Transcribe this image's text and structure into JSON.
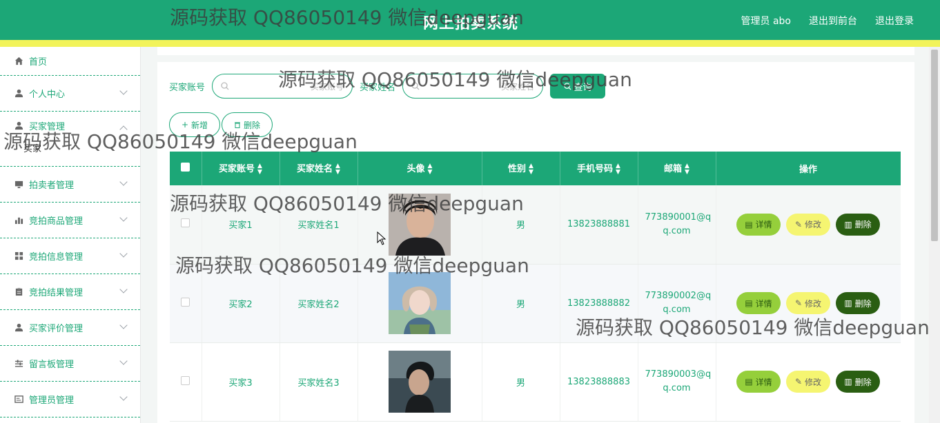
{
  "header": {
    "title": "网上拍卖系统",
    "user_label": "管理员 abo",
    "front_link": "退出到前台",
    "logout_link": "退出登录",
    "bg_color": "#1ca777",
    "stripe_color": "#f2f35a"
  },
  "sidebar": {
    "items": [
      {
        "label": "首页",
        "icon": "home-icon"
      },
      {
        "label": "个人中心",
        "icon": "user-icon"
      },
      {
        "label": "买家管理",
        "icon": "people-icon"
      },
      {
        "label": "拍卖者管理",
        "icon": "monitor-icon"
      },
      {
        "label": "竞拍商品管理",
        "icon": "bar-chart-icon"
      },
      {
        "label": "竞拍信息管理",
        "icon": "grid-icon"
      },
      {
        "label": "竞拍结果管理",
        "icon": "clipboard-icon"
      },
      {
        "label": "买家评价管理",
        "icon": "user-icon"
      },
      {
        "label": "留言板管理",
        "icon": "sliders-icon"
      },
      {
        "label": "管理员管理",
        "icon": "card-icon"
      }
    ],
    "sub_item": "买家"
  },
  "search": {
    "account_label": "买家账号",
    "account_placeholder": "买家账号",
    "name_label": "买家姓名",
    "name_placeholder": "买家姓名",
    "query_button": "查询"
  },
  "actions": {
    "add": "新增",
    "delete": "删除"
  },
  "table": {
    "columns": [
      "买家账号",
      "买家姓名",
      "头像",
      "性别",
      "手机号码",
      "邮箱",
      "操作"
    ],
    "rows": [
      {
        "account": "买家1",
        "name": "买家姓名1",
        "gender": "男",
        "phone": "13823888881",
        "email_a": "773890001@q",
        "email_b": "q.com"
      },
      {
        "account": "买家2",
        "name": "买家姓名2",
        "gender": "男",
        "phone": "13823888882",
        "email_a": "773890002@q",
        "email_b": "q.com"
      },
      {
        "account": "买家3",
        "name": "买家姓名3",
        "gender": "男",
        "phone": "13823888883",
        "email_a": "773890003@q",
        "email_b": "q.com"
      }
    ],
    "ops": {
      "detail": "详情",
      "edit": "修改",
      "delete": "删除"
    }
  },
  "watermark": "源码获取 QQ86050149 微信deepguan"
}
